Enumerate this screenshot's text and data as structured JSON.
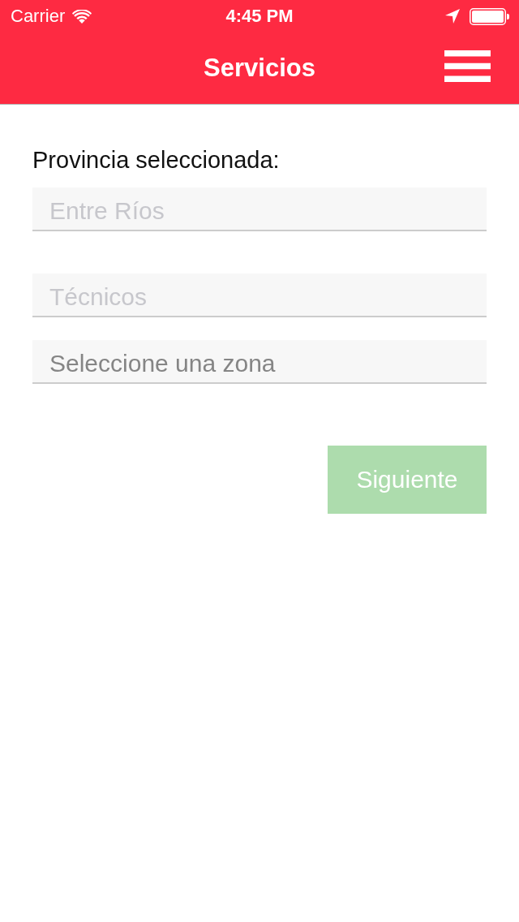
{
  "status_bar": {
    "carrier": "Carrier",
    "time": "4:45 PM"
  },
  "nav_bar": {
    "title": "Servicios"
  },
  "province": {
    "label": "Provincia seleccionada:",
    "field": {
      "placeholder": "Entre Ríos"
    }
  },
  "fields": [
    {
      "placeholder": "Técnicos"
    },
    {
      "value": "Seleccione una zona"
    }
  ],
  "next_button": {
    "label": "Siguiente",
    "disabled": true
  }
}
